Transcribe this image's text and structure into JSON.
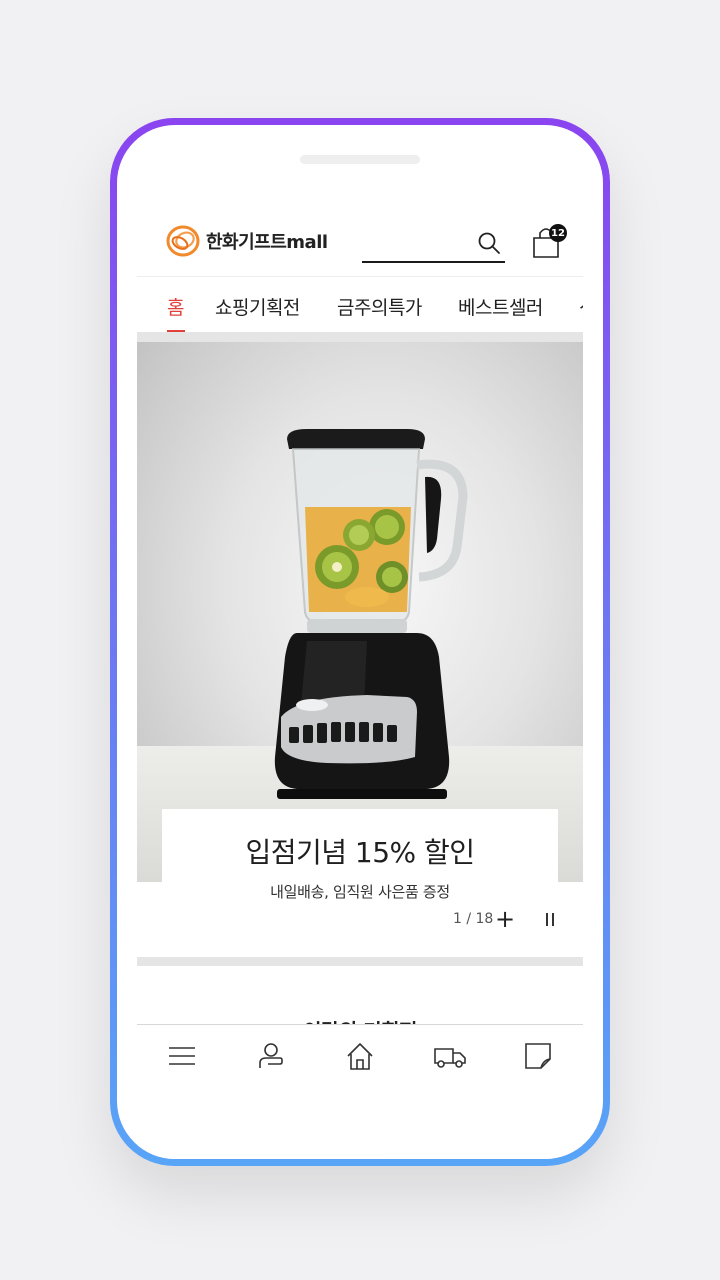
{
  "header": {
    "logo_text": "한화기프트mall",
    "search_placeholder": "",
    "cart_count": "12"
  },
  "tabs": [
    {
      "label": "홈",
      "active": true
    },
    {
      "label": "쇼핑기획전"
    },
    {
      "label": "금주의특가"
    },
    {
      "label": "베스트셀러"
    },
    {
      "label": "신"
    }
  ],
  "banner": {
    "title": "입점기념 15% 할인",
    "subtitle": "내일배송, 임직원 사은품 증정",
    "pager": "1 / 18",
    "plus_symbol": "+"
  },
  "section": {
    "title": "이달의 기획전"
  },
  "bottom_nav": [
    {
      "icon": "menu-icon"
    },
    {
      "icon": "user-icon"
    },
    {
      "icon": "home-icon"
    },
    {
      "icon": "delivery-truck-icon"
    },
    {
      "icon": "recent-view-icon"
    }
  ],
  "colors": {
    "accent": "#e2413b",
    "frame_top": "#8a44f0",
    "frame_bottom": "#58a4f7"
  }
}
